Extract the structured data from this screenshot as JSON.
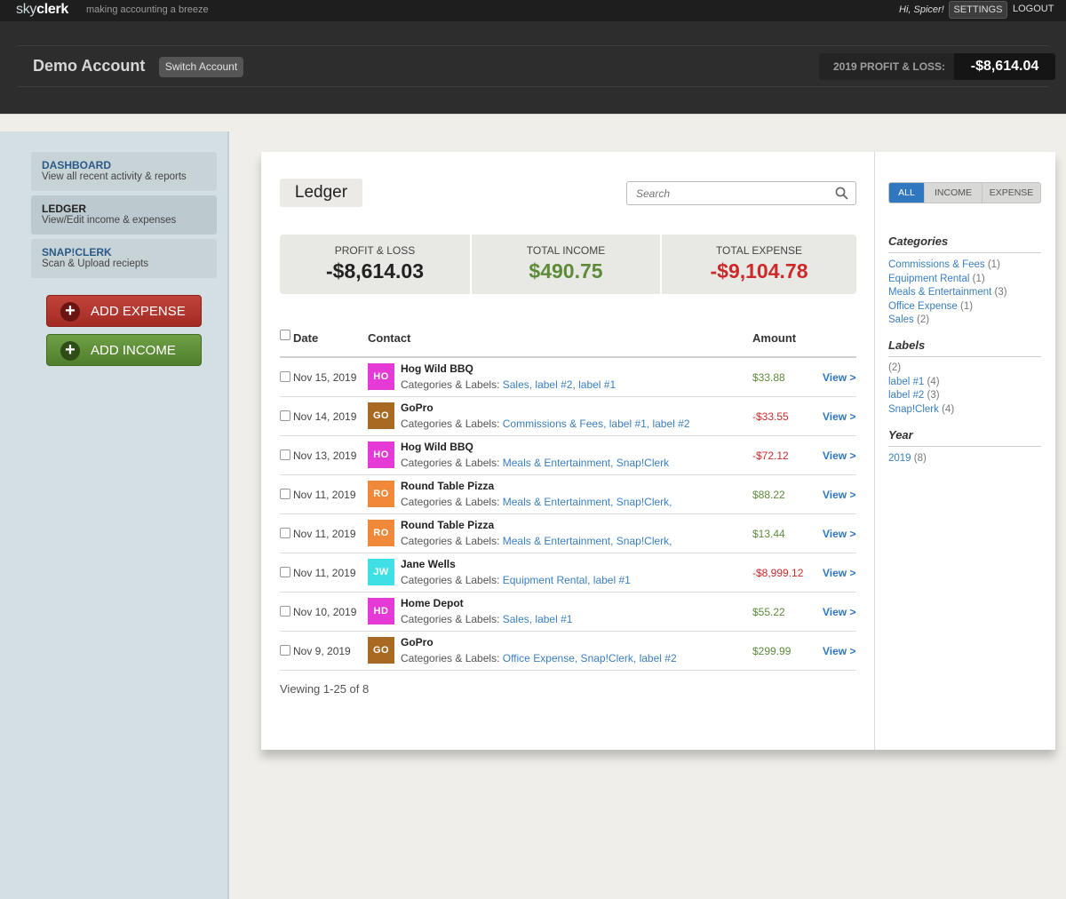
{
  "app": {
    "logo_light": "sky",
    "logo_bold": "clerk",
    "tagline": "making accounting a breeze",
    "greeting": "Hi, Spicer!",
    "settings_label": "SETTINGS",
    "logout_label": "LOGOUT"
  },
  "account": {
    "name": "Demo Account",
    "switch_label": "Switch Account",
    "pl_label": "2019 PROFIT & LOSS:",
    "pl_value": "-$8,614.04"
  },
  "sidebar": {
    "items": [
      {
        "title": "DASHBOARD",
        "subtitle": "View all recent activity & reports"
      },
      {
        "title": "LEDGER",
        "subtitle": "View/Edit income & expenses"
      },
      {
        "title": "SNAP!CLERK",
        "subtitle": "Scan & Upload reciepts"
      }
    ],
    "add_expense_label": "ADD EXPENSE",
    "add_income_label": "ADD INCOME"
  },
  "ledger": {
    "title": "Ledger",
    "search_placeholder": "Search",
    "stats": [
      {
        "label": "PROFIT & LOSS",
        "value": "-$8,614.03",
        "color": "#222222"
      },
      {
        "label": "TOTAL INCOME",
        "value": "$490.75",
        "color": "#5d8b3a"
      },
      {
        "label": "TOTAL EXPENSE",
        "value": "-$9,104.78",
        "color": "#cc2a2a"
      }
    ],
    "columns": {
      "date": "Date",
      "contact": "Contact",
      "amount": "Amount"
    },
    "cats_prefix": "Categories & Labels: ",
    "view_label": "View >",
    "rows": [
      {
        "date": "Nov 15, 2019",
        "initials": "HO",
        "avatar_color": "#e53ad6",
        "contact": "Hog Wild BBQ",
        "cats": "Sales, label #2, label #1",
        "amount": "$33.88",
        "sign": "pos"
      },
      {
        "date": "Nov 14, 2019",
        "initials": "GO",
        "avatar_color": "#a86a22",
        "contact": "GoPro",
        "cats": "Commissions & Fees, label #1, label #2",
        "amount": "-$33.55",
        "sign": "neg"
      },
      {
        "date": "Nov 13, 2019",
        "initials": "HO",
        "avatar_color": "#e53ad6",
        "contact": "Hog Wild BBQ",
        "cats": "Meals & Entertainment, Snap!Clerk",
        "amount": "-$72.12",
        "sign": "neg"
      },
      {
        "date": "Nov 11, 2019",
        "initials": "RO",
        "avatar_color": "#f08a3a",
        "contact": "Round Table Pizza",
        "cats": "Meals & Entertainment, Snap!Clerk,",
        "amount": "$88.22",
        "sign": "pos"
      },
      {
        "date": "Nov 11, 2019",
        "initials": "RO",
        "avatar_color": "#f08a3a",
        "contact": "Round Table Pizza",
        "cats": "Meals & Entertainment, Snap!Clerk,",
        "amount": "$13.44",
        "sign": "pos"
      },
      {
        "date": "Nov 11, 2019",
        "initials": "JW",
        "avatar_color": "#3ee0e6",
        "contact": "Jane Wells",
        "cats": "Equipment Rental, label #1",
        "amount": "-$8,999.12",
        "sign": "neg"
      },
      {
        "date": "Nov 10, 2019",
        "initials": "HD",
        "avatar_color": "#e53ad6",
        "contact": "Home Depot",
        "cats": "Sales, label #1",
        "amount": "$55.22",
        "sign": "pos"
      },
      {
        "date": "Nov 9, 2019",
        "initials": "GO",
        "avatar_color": "#a86a22",
        "contact": "GoPro",
        "cats": "Office Expense, Snap!Clerk, label #2",
        "amount": "$299.99",
        "sign": "pos"
      }
    ],
    "viewing_text": "Viewing 1-25 of 8"
  },
  "filters": {
    "all": "ALL",
    "income": "INCOME",
    "expense": "EXPENSE",
    "categories_title": "Categories",
    "categories": [
      {
        "name": "Commissions & Fees",
        "count": "(1)"
      },
      {
        "name": "Equipment Rental",
        "count": "(1)"
      },
      {
        "name": "Meals & Entertainment",
        "count": "(3)"
      },
      {
        "name": "Office Expense",
        "count": "(1)"
      },
      {
        "name": "Sales",
        "count": "(2)"
      }
    ],
    "labels_title": "Labels",
    "labels": [
      {
        "name": "",
        "count": "(2)"
      },
      {
        "name": "label #1",
        "count": "(4)"
      },
      {
        "name": "label #2",
        "count": "(3)"
      },
      {
        "name": "Snap!Clerk",
        "count": "(4)"
      }
    ],
    "year_title": "Year",
    "years": [
      {
        "name": "2019",
        "count": "(8)"
      }
    ]
  }
}
